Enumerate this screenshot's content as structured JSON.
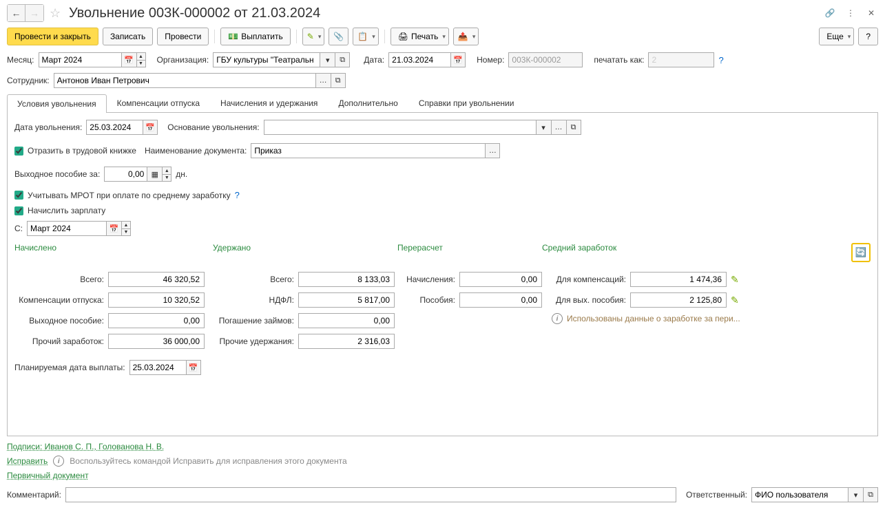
{
  "title": "Увольнение 003К-000002 от 21.03.2024",
  "toolbar": {
    "post_close": "Провести и закрыть",
    "save": "Записать",
    "post": "Провести",
    "pay": "Выплатить",
    "print": "Печать",
    "more": "Еще"
  },
  "header": {
    "month_label": "Месяц:",
    "month_value": "Март 2024",
    "org_label": "Организация:",
    "org_value": "ГБУ культуры \"Театральн",
    "date_label": "Дата:",
    "date_value": "21.03.2024",
    "number_label": "Номер:",
    "number_value": "003К-000002",
    "print_as_label": "печатать как:",
    "print_as_value": "2",
    "employee_label": "Сотрудник:",
    "employee_value": "Антонов Иван Петрович"
  },
  "tabs": [
    "Условия увольнения",
    "Компенсации отпуска",
    "Начисления и удержания",
    "Дополнительно",
    "Справки при увольнении"
  ],
  "conditions": {
    "dismissal_date_label": "Дата увольнения:",
    "dismissal_date": "25.03.2024",
    "reason_label": "Основание увольнения:",
    "reason_value": "",
    "workbook_label": "Отразить в трудовой книжке",
    "doc_name_label": "Наименование документа:",
    "doc_name": "Приказ",
    "severance_label": "Выходное пособие за:",
    "severance_value": "0,00",
    "severance_unit": "дн.",
    "mrot_label": "Учитывать МРОТ при оплате по среднему заработку",
    "accrue_salary_label": "Начислить зарплату",
    "from_label": "С:",
    "from_value": "Март 2024"
  },
  "sections": {
    "accrued": "Начислено",
    "withheld": "Удержано",
    "recalc": "Перерасчет",
    "avg": "Средний заработок"
  },
  "accrued": {
    "total_label": "Всего:",
    "total": "46 320,52",
    "vacation_label": "Компенсации отпуска:",
    "vacation": "10 320,52",
    "severance_label": "Выходное пособие:",
    "severance": "0,00",
    "other_label": "Прочий заработок:",
    "other": "36 000,00"
  },
  "withheld": {
    "total_label": "Всего:",
    "total": "8 133,03",
    "ndfl_label": "НДФЛ:",
    "ndfl": "5 817,00",
    "loan_label": "Погашение займов:",
    "loan": "0,00",
    "other_label": "Прочие удержания:",
    "other": "2 316,03"
  },
  "recalc": {
    "accruals_label": "Начисления:",
    "accruals": "0,00",
    "benefits_label": "Пособия:",
    "benefits": "0,00"
  },
  "avg": {
    "comp_label": "Для компенсаций:",
    "comp": "1 474,36",
    "sev_label": "Для вых. пособия:",
    "sev": "2 125,80",
    "info_text": "Использованы данные о заработке за пери..."
  },
  "planned_date_label": "Планируемая дата выплаты:",
  "planned_date": "25.03.2024",
  "links": {
    "signatures": "Подписи: Иванов С. П., Голованова Н. В.",
    "correct": "Исправить",
    "correct_hint": "Воспользуйтесь командой Исправить для исправления этого документа",
    "source_doc": "Первичный документ"
  },
  "footer": {
    "comment_label": "Комментарий:",
    "responsible_label": "Ответственный:",
    "responsible_value": "ФИО пользователя"
  }
}
